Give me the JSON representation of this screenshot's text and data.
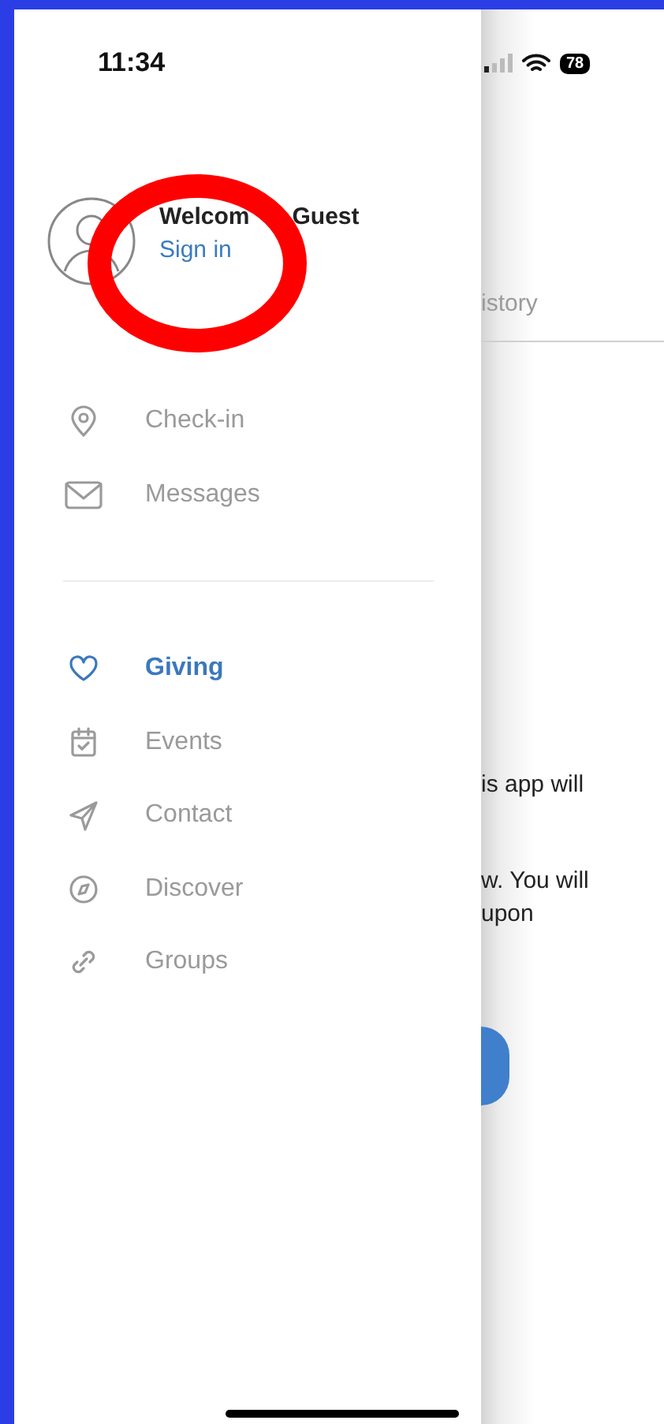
{
  "status_bar": {
    "time": "11:34",
    "battery": "78"
  },
  "drawer": {
    "greeting_parts": [
      "Welcom",
      "Guest"
    ],
    "sign_in": "Sign in",
    "sections": [
      [
        {
          "label": "Check-in",
          "selected": false
        },
        {
          "label": "Messages",
          "selected": false
        }
      ],
      [
        {
          "label": "Giving",
          "selected": true
        },
        {
          "label": "Events",
          "selected": false
        },
        {
          "label": "Contact",
          "selected": false
        },
        {
          "label": "Discover",
          "selected": false
        },
        {
          "label": "Groups",
          "selected": false
        }
      ]
    ]
  },
  "background_page": {
    "tab": "istory",
    "text_lines": [
      "is app will",
      "w. You will",
      "upon"
    ]
  }
}
